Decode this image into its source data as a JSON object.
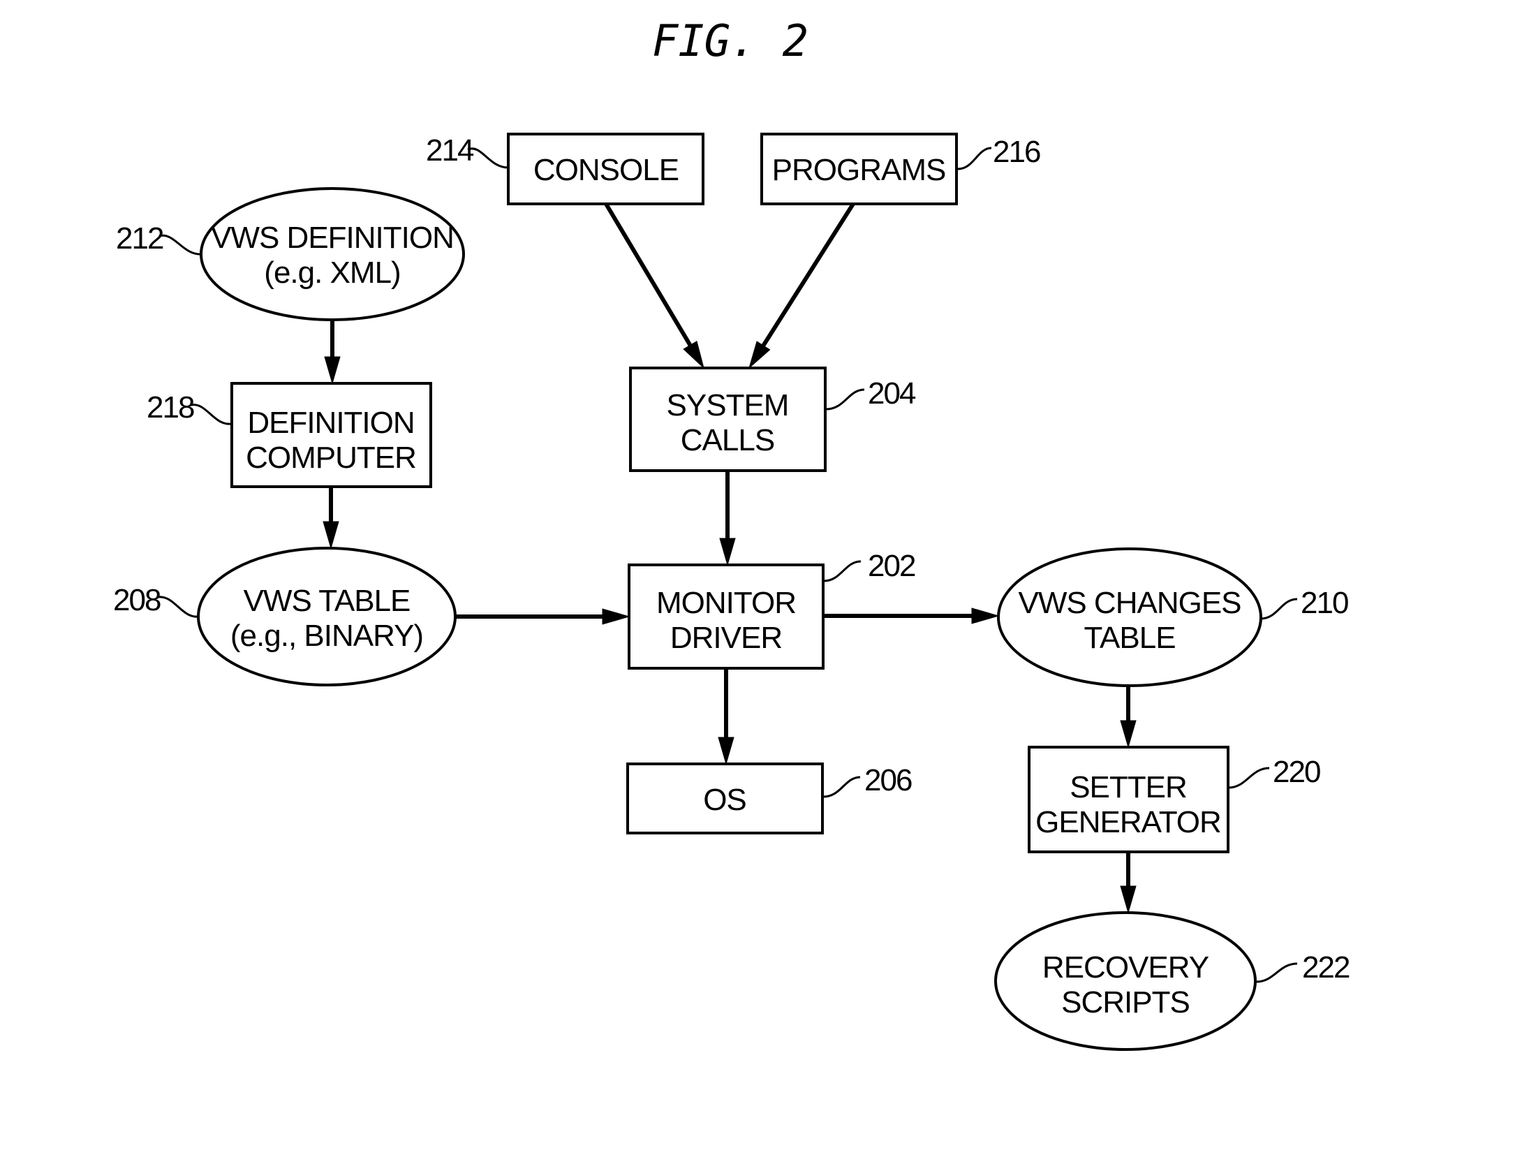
{
  "figure": {
    "title": "FIG. 2"
  },
  "nodes": {
    "console": {
      "ref": "214",
      "shape": "box",
      "lines": [
        "CONSOLE"
      ]
    },
    "programs": {
      "ref": "216",
      "shape": "box",
      "lines": [
        "PROGRAMS"
      ]
    },
    "vws_definition": {
      "ref": "212",
      "shape": "ellipse",
      "lines": [
        "VWS DEFINITION",
        "(e.g. XML)"
      ]
    },
    "definition_computer": {
      "ref": "218",
      "shape": "box",
      "lines": [
        "DEFINITION",
        "COMPUTER"
      ]
    },
    "system_calls": {
      "ref": "204",
      "shape": "box",
      "lines": [
        "SYSTEM",
        "CALLS"
      ]
    },
    "vws_table": {
      "ref": "208",
      "shape": "ellipse",
      "lines": [
        "VWS TABLE",
        "(e.g., BINARY)"
      ]
    },
    "monitor_driver": {
      "ref": "202",
      "shape": "box",
      "lines": [
        "MONITOR",
        "DRIVER"
      ]
    },
    "os": {
      "ref": "206",
      "shape": "box",
      "lines": [
        "OS"
      ]
    },
    "vws_changes_table": {
      "ref": "210",
      "shape": "ellipse",
      "lines": [
        "VWS CHANGES",
        "TABLE"
      ]
    },
    "setter_generator": {
      "ref": "220",
      "shape": "box",
      "lines": [
        "SETTER",
        "GENERATOR"
      ]
    },
    "recovery_scripts": {
      "ref": "222",
      "shape": "ellipse",
      "lines": [
        "RECOVERY",
        "SCRIPTS"
      ]
    }
  },
  "edges": [
    {
      "from": "vws_definition",
      "to": "definition_computer"
    },
    {
      "from": "definition_computer",
      "to": "vws_table"
    },
    {
      "from": "console",
      "to": "system_calls"
    },
    {
      "from": "programs",
      "to": "system_calls"
    },
    {
      "from": "system_calls",
      "to": "monitor_driver"
    },
    {
      "from": "vws_table",
      "to": "monitor_driver"
    },
    {
      "from": "monitor_driver",
      "to": "os"
    },
    {
      "from": "monitor_driver",
      "to": "vws_changes_table"
    },
    {
      "from": "vws_changes_table",
      "to": "setter_generator"
    },
    {
      "from": "setter_generator",
      "to": "recovery_scripts"
    }
  ]
}
